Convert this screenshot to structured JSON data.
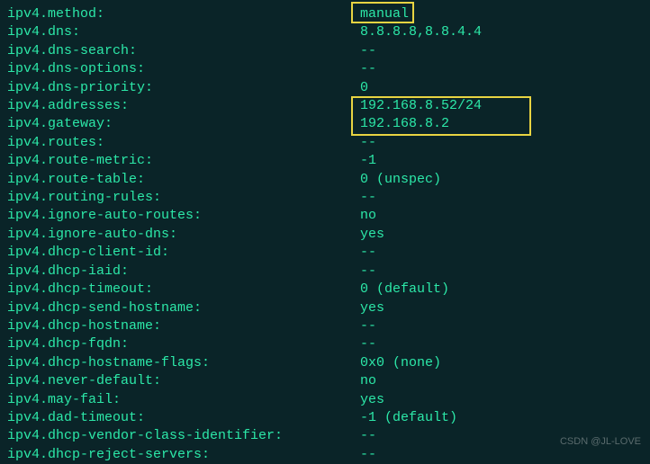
{
  "rows": [
    {
      "key": "ipv4.method:",
      "value": "manual"
    },
    {
      "key": "ipv4.dns:",
      "value": "8.8.8.8,8.8.4.4"
    },
    {
      "key": "ipv4.dns-search:",
      "value": "--"
    },
    {
      "key": "ipv4.dns-options:",
      "value": "--"
    },
    {
      "key": "ipv4.dns-priority:",
      "value": "0"
    },
    {
      "key": "ipv4.addresses:",
      "value": "192.168.8.52/24"
    },
    {
      "key": "ipv4.gateway:",
      "value": "192.168.8.2"
    },
    {
      "key": "ipv4.routes:",
      "value": "--"
    },
    {
      "key": "ipv4.route-metric:",
      "value": "-1"
    },
    {
      "key": "ipv4.route-table:",
      "value": "0 (unspec)"
    },
    {
      "key": "ipv4.routing-rules:",
      "value": "--"
    },
    {
      "key": "ipv4.ignore-auto-routes:",
      "value": "no"
    },
    {
      "key": "ipv4.ignore-auto-dns:",
      "value": "yes"
    },
    {
      "key": "ipv4.dhcp-client-id:",
      "value": "--"
    },
    {
      "key": "ipv4.dhcp-iaid:",
      "value": "--"
    },
    {
      "key": "ipv4.dhcp-timeout:",
      "value": "0 (default)"
    },
    {
      "key": "ipv4.dhcp-send-hostname:",
      "value": "yes"
    },
    {
      "key": "ipv4.dhcp-hostname:",
      "value": "--"
    },
    {
      "key": "ipv4.dhcp-fqdn:",
      "value": "--"
    },
    {
      "key": "ipv4.dhcp-hostname-flags:",
      "value": "0x0 (none)"
    },
    {
      "key": "ipv4.never-default:",
      "value": "no"
    },
    {
      "key": "ipv4.may-fail:",
      "value": "yes"
    },
    {
      "key": "ipv4.dad-timeout:",
      "value": "-1 (default)"
    },
    {
      "key": "ipv4.dhcp-vendor-class-identifier:",
      "value": "--"
    },
    {
      "key": "ipv4.dhcp-reject-servers:",
      "value": "--"
    }
  ],
  "watermark": "CSDN @JL-LOVE"
}
